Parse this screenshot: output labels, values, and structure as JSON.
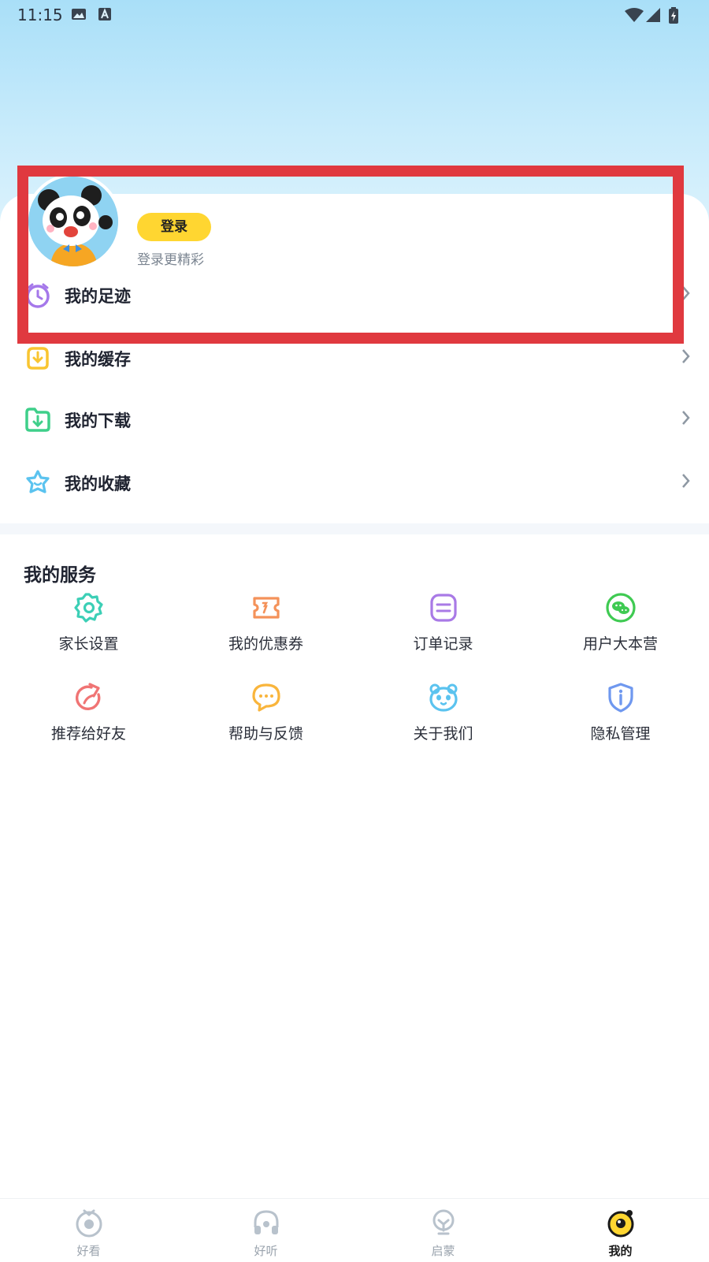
{
  "status_bar": {
    "time": "11:15"
  },
  "profile": {
    "login_label": "登录",
    "login_subtitle": "登录更精彩"
  },
  "menu": [
    {
      "label": "我的足迹",
      "icon": "clock-icon",
      "color": "#a578ea"
    },
    {
      "label": "我的缓存",
      "icon": "cache-download-icon",
      "color": "#f9c531"
    },
    {
      "label": "我的下载",
      "icon": "folder-download-icon",
      "color": "#3fcf8a"
    },
    {
      "label": "我的收藏",
      "icon": "star-face-icon",
      "color": "#5bc3ef"
    }
  ],
  "services": {
    "title": "我的服务",
    "items": [
      {
        "label": "家长设置",
        "icon": "gear-icon",
        "color": "#3ccfb6"
      },
      {
        "label": "我的优惠券",
        "icon": "coupon-icon",
        "color": "#f4925a"
      },
      {
        "label": "订单记录",
        "icon": "order-list-icon",
        "color": "#a97ae6"
      },
      {
        "label": "用户大本营",
        "icon": "wechat-icon",
        "color": "#3fca52"
      },
      {
        "label": "推荐给好友",
        "icon": "share-arrow-icon",
        "color": "#f07474"
      },
      {
        "label": "帮助与反馈",
        "icon": "chat-bubble-icon",
        "color": "#f9b53c"
      },
      {
        "label": "关于我们",
        "icon": "panda-face-icon",
        "color": "#5bc3ef"
      },
      {
        "label": "隐私管理",
        "icon": "info-shield-icon",
        "color": "#6f98ef"
      }
    ]
  },
  "bottom_nav": [
    {
      "label": "好看",
      "icon": "tv-icon",
      "active": false
    },
    {
      "label": "好听",
      "icon": "headphones-icon",
      "active": false
    },
    {
      "label": "启蒙",
      "icon": "bulb-icon",
      "active": false
    },
    {
      "label": "我的",
      "icon": "me-face-icon",
      "active": true
    }
  ],
  "colors": {
    "accent_yellow": "#ffd631",
    "highlight_red": "#e0393f",
    "sky_blue": "#a9dff8"
  }
}
